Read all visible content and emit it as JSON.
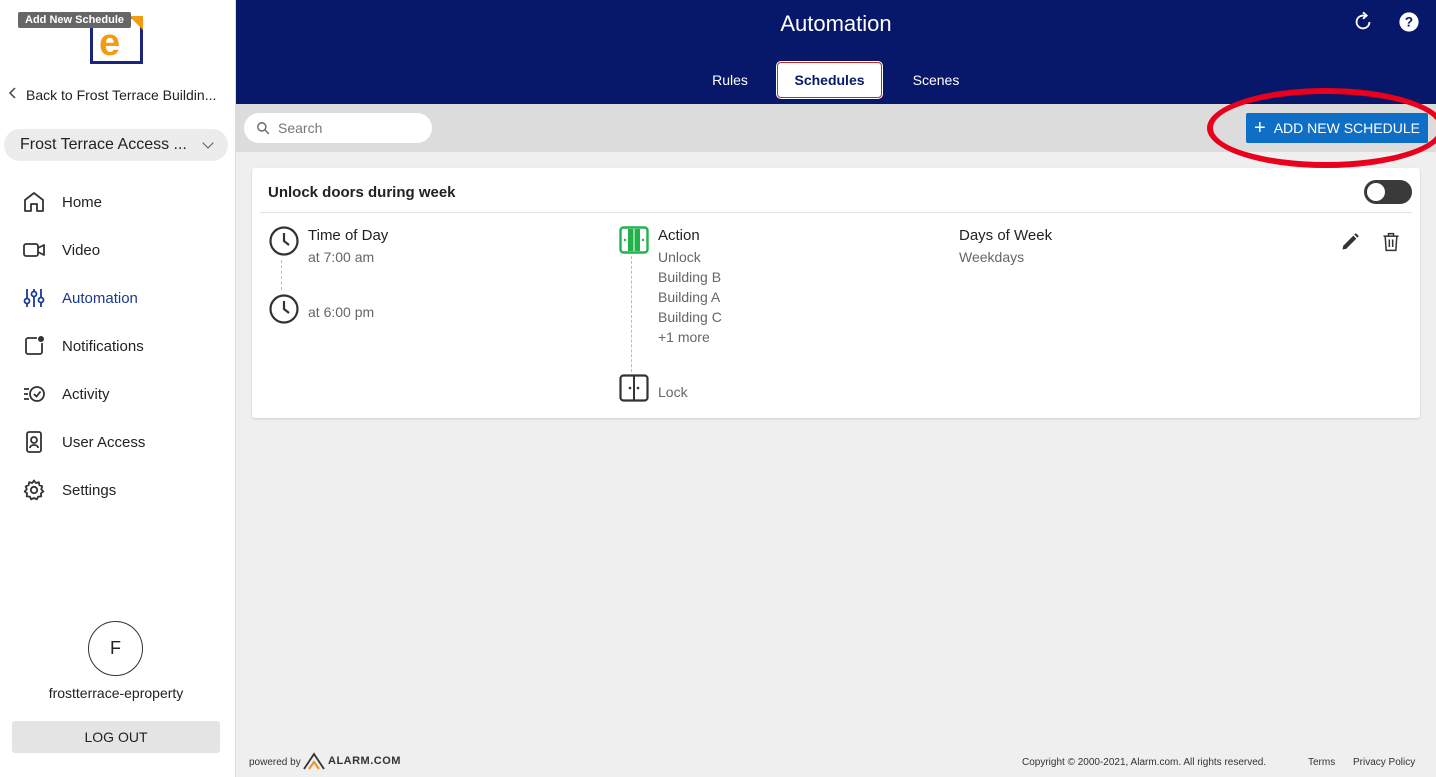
{
  "tooltip": "Add New Schedule",
  "sidebar": {
    "back_label": "Back to Frost Terrace Buildin...",
    "site_name": "Frost Terrace Access ...",
    "items": [
      {
        "label": "Home",
        "icon": "home-icon"
      },
      {
        "label": "Video",
        "icon": "video-icon"
      },
      {
        "label": "Automation",
        "icon": "sliders-icon",
        "active": true
      },
      {
        "label": "Notifications",
        "icon": "notification-icon"
      },
      {
        "label": "Activity",
        "icon": "activity-icon"
      },
      {
        "label": "User Access",
        "icon": "user-badge-icon"
      },
      {
        "label": "Settings",
        "icon": "gear-icon"
      }
    ],
    "avatar_initial": "F",
    "username": "frostterrace-eproperty",
    "logout_label": "LOG OUT"
  },
  "header": {
    "title": "Automation",
    "tabs": [
      {
        "label": "Rules",
        "active": false
      },
      {
        "label": "Schedules",
        "active": true
      },
      {
        "label": "Scenes",
        "active": false
      }
    ]
  },
  "toolbar": {
    "search_placeholder": "Search",
    "add_button_label": "ADD NEW SCHEDULE"
  },
  "schedule": {
    "title": "Unlock doors during week",
    "enabled": false,
    "time": {
      "label": "Time of Day",
      "start": "at 7:00 am",
      "end": "at 6:00 pm"
    },
    "action": {
      "label": "Action",
      "start_action": "Unlock",
      "targets": [
        "Building B",
        "Building A",
        "Building C"
      ],
      "more": "+1 more",
      "end_action": "Lock"
    },
    "days": {
      "label": "Days of Week",
      "value": "Weekdays"
    }
  },
  "footer": {
    "powered_by": "powered by",
    "brand": "ALARM.COM",
    "copyright": "Copyright © 2000-2021, Alarm.com. All rights reserved.",
    "terms": "Terms",
    "privacy": "Privacy Policy"
  },
  "colors": {
    "header_bg": "#07186b",
    "accent_blue": "#0f6fc6",
    "active_nav": "#1a3a8f",
    "unlock_green": "#21b24b",
    "highlight_red": "#e8001c"
  }
}
